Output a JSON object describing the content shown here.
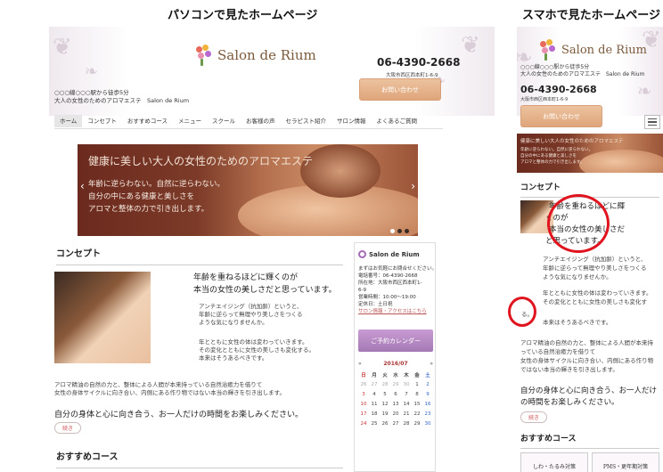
{
  "captions": {
    "pc": "パソコンで見たホームページ",
    "sp": "スマホで見たホームページ"
  },
  "site": {
    "name": "Salon de Rium",
    "access_line1": "○○○線○○○駅から徒歩5分",
    "access_line2": "大人の女性のためのアロマエステ　Salon de Rium",
    "phone": "06-4390-2668",
    "address": "大阪市西区西本町1-6-9",
    "contact_button": "お問い合わせ"
  },
  "nav": [
    "ホーム",
    "コンセプト",
    "おすすめコース",
    "メニュー",
    "スクール",
    "お客様の声",
    "セラピスト紹介",
    "サロン情報",
    "よくあるご質問"
  ],
  "hero": {
    "title": "健康に美しい大人の女性のためのアロマエステ",
    "sub_line1": "年齢に逆らわない。自然に逆らわない。",
    "sub_line2": "自分の中にある健康と美しさを",
    "sub_line3": "アロマと整体の力で引き出します。",
    "prev_arrow": "‹",
    "next_arrow": "›"
  },
  "concept": {
    "title": "コンセプト",
    "head_line1": "年齢を重ねるほどに輝くのが",
    "head_line2": "本当の女性の美しさだと思っています。",
    "text1_line1": "アンチエイジング（抗加齢）というと、",
    "text1_line2": "年齢に逆らって無理やり美しさをつくる",
    "text1_line3": "ような気になりませんか。",
    "text2_line1": "年とともに女性の体は変わっていきます。",
    "text2_line2": "その変化とともに女性の美しさも変化する。",
    "text2_line3": "本来はそうあるべきです。",
    "text3_line1": "アロマ精油の自然の力と、整体による人間が本来持っている自然治癒力を借りて",
    "text3_line2": "女性の身体サイクルに向き合い、内側にある作り物ではない本当の輝きを引き出します。",
    "closing": "自分の身体と心に向き合う、お一人だけの時間をお楽しみください。",
    "more_button": "続き"
  },
  "recommend": {
    "title": "おすすめコース"
  },
  "sidebar": {
    "name": "Salon de Rium",
    "greeting": "まずはお気軽にお問合せください。",
    "tel": "電話番号：06-4390-2668",
    "addr1": "所在地：大阪市西区西本町1-",
    "addr2": "6-9",
    "hours": "営業時間：10:00～19:00",
    "closed": "定休日：土日祝",
    "link": "サロン情報・アクセスはこちら",
    "calendar_button": "ご予約カレンダー"
  },
  "calendar": {
    "month": "2016/07",
    "prev": "«",
    "next": "»",
    "dow": [
      "日",
      "月",
      "火",
      "水",
      "木",
      "金",
      "土"
    ],
    "cells": [
      {
        "d": "26",
        "c": "grey"
      },
      {
        "d": "27",
        "c": "grey"
      },
      {
        "d": "28",
        "c": "grey"
      },
      {
        "d": "29",
        "c": "grey"
      },
      {
        "d": "30",
        "c": "grey"
      },
      {
        "d": "1",
        "c": ""
      },
      {
        "d": "2",
        "c": "sat"
      },
      {
        "d": "3",
        "c": "sun"
      },
      {
        "d": "4",
        "c": ""
      },
      {
        "d": "5",
        "c": ""
      },
      {
        "d": "6",
        "c": ""
      },
      {
        "d": "7",
        "c": ""
      },
      {
        "d": "8",
        "c": ""
      },
      {
        "d": "9",
        "c": "sat"
      },
      {
        "d": "10",
        "c": "sun"
      },
      {
        "d": "11",
        "c": ""
      },
      {
        "d": "12",
        "c": ""
      },
      {
        "d": "13",
        "c": ""
      },
      {
        "d": "14",
        "c": ""
      },
      {
        "d": "15",
        "c": ""
      },
      {
        "d": "16",
        "c": "sat"
      },
      {
        "d": "17",
        "c": "sun"
      },
      {
        "d": "18",
        "c": ""
      },
      {
        "d": "19",
        "c": ""
      },
      {
        "d": "20",
        "c": ""
      },
      {
        "d": "21",
        "c": ""
      },
      {
        "d": "22",
        "c": ""
      },
      {
        "d": "23",
        "c": "sat"
      },
      {
        "d": "24",
        "c": "sun"
      },
      {
        "d": "25",
        "c": ""
      },
      {
        "d": "26",
        "c": ""
      },
      {
        "d": "27",
        "c": ""
      },
      {
        "d": "28",
        "c": ""
      },
      {
        "d": "29",
        "c": ""
      },
      {
        "d": "30",
        "c": "sat"
      }
    ]
  },
  "sp": {
    "hero_title": "健康に美しい大人の女性のためのアロマエステ",
    "hero_sub1": "年齢に逆らわない。自然に逆らわない。",
    "hero_sub2": "自分の中にある健康と美しさを",
    "hero_sub3": "アロマと整体の力で引き出します。",
    "concept_title": "コンセプト",
    "head_line1": "年齢を重ねるほどに輝",
    "head_line2": "くのが",
    "head_line3": "本当の女性の美しさだ",
    "head_line4": "と思っています。",
    "text1_line1": "アンチエイジング（抗加齢）というと、",
    "text1_line2": "年齢に逆らって無理やり美しさをつくる",
    "text1_line3": "ような気になりませんか。",
    "text2_line1": "年とともに女性の体は変わっていきます。",
    "text2_line2": "その変化とともに女性の美しさも変化す",
    "stray_char": "る。",
    "text4": "本来はそうあるべきです。",
    "text3_line1": "アロマ精油の自然の力と、整体による人間が本来持",
    "text3_line2": "っている自然治癒力を借りて",
    "text3_line3": "女性の身体サイクルに向き合い、内側にある作り物",
    "text3_line4": "ではない本当の輝きを引き出します。",
    "closing_line1": "自分の身体と心に向き合う、お一人だけ",
    "closing_line2": "の時間をお楽しみください。",
    "more_button": "続き",
    "recommend_title": "おすすめコース",
    "card1": "しわ・たるみ対策",
    "card2": "PMS・更年期対策"
  },
  "colors": {
    "accent_orange": "#e0a47c",
    "accent_purple": "#a479b3",
    "annotation_red": "#e0141e"
  }
}
